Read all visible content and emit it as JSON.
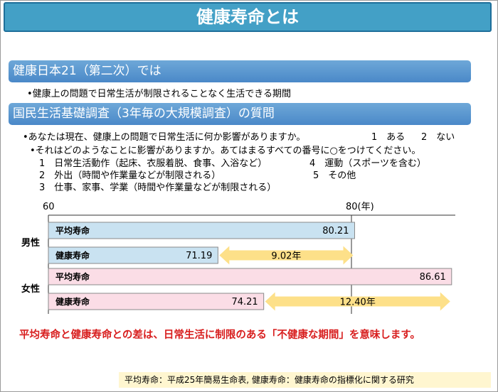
{
  "title": "健康寿命とは",
  "section1": {
    "heading": "健康日本21（第二次）では",
    "bullet": "•健康上の問題で日常生活が制限されることなく生活できる期間"
  },
  "section2": {
    "heading": "国民生活基礎調査（3年毎の大規模調査）の質問",
    "q1": "•あなたは現在、健康上の問題で日常生活に何か影響がありますか。",
    "q1_a1": "1　ある",
    "q1_a2": "2　ない",
    "q2": "•それはどのようなことに影響がありますか。あてはまるすべての番号に○をつけてください。",
    "opt1": "1　日常生活動作（起床、衣服着脱、食事、入浴など）",
    "opt2": "2　外出（時間や作業量などが制限される）",
    "opt3": "3　仕事、家事、学業（時間や作業量などが制限される）",
    "opt4": "4　運動（スポーツを含む）",
    "opt5": "5　その他"
  },
  "chart_data": {
    "type": "bar",
    "orientation": "horizontal",
    "x_ticks": [
      "60",
      "80(年)"
    ],
    "xlim": [
      60,
      90
    ],
    "groups": [
      {
        "label": "男性",
        "bars": [
          {
            "name": "平均寿命",
            "value": 80.21,
            "value_label": "80.21",
            "color": "#c9e2f1"
          },
          {
            "name": "健康寿命",
            "value": 71.19,
            "value_label": "71.19",
            "color": "#c9e2f1"
          }
        ],
        "gap_label": "9.02年"
      },
      {
        "label": "女性",
        "bars": [
          {
            "name": "平均寿命",
            "value": 86.61,
            "value_label": "86.61",
            "color": "#fbdde6"
          },
          {
            "name": "健康寿命",
            "value": 74.21,
            "value_label": "74.21",
            "color": "#fbdde6"
          }
        ],
        "gap_label": "12.40年"
      }
    ],
    "arrow_color": "#fde089"
  },
  "note": "平均寿命と健康寿命との差は、日常生活に制限のある「不健康な期間」を意味します。",
  "footer": "平均寿命：平成25年簡易生命表, 健康寿命：健康寿命の指標化に関する研究"
}
